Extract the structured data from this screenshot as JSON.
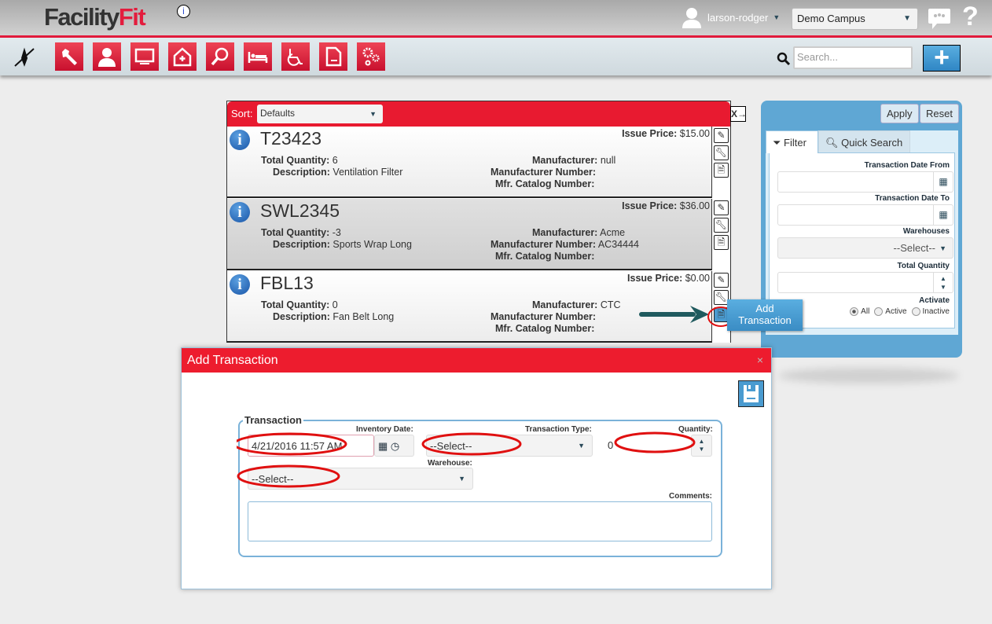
{
  "header": {
    "logo_a": "Facility",
    "logo_b": "Fit",
    "info": "i",
    "user": "larson-rodger",
    "campus": "Demo Campus"
  },
  "toolbar": {
    "nav_icons": [
      "wrench",
      "user",
      "monitor",
      "home-plus",
      "magnifier",
      "bed",
      "wheelchair",
      "document",
      "gears"
    ],
    "search_placeholder": "Search...",
    "add_label": "+"
  },
  "list": {
    "sort_label": "Sort:",
    "sort_value": "Defaults",
    "labels": {
      "issue_price": "Issue Price:",
      "total_quantity": "Total Quantity:",
      "description": "Description:",
      "manufacturer": "Manufacturer:",
      "manufacturer_number": "Manufacturer Number:",
      "catalog_number": "Mfr. Catalog Number:"
    },
    "items": [
      {
        "code": "T23423",
        "issue_price": "$15.00",
        "total_quantity": "6",
        "description": "Ventilation Filter",
        "manufacturer": "null",
        "manufacturer_number": "",
        "catalog_number": ""
      },
      {
        "code": "SWL2345",
        "issue_price": "$36.00",
        "total_quantity": "-3",
        "description": "Sports Wrap Long",
        "manufacturer": "Acme",
        "manufacturer_number": "AC34444",
        "catalog_number": ""
      },
      {
        "code": "FBL13",
        "issue_price": "$0.00",
        "total_quantity": "0",
        "description": "Fan Belt Long",
        "manufacturer": "CTC",
        "manufacturer_number": "",
        "catalog_number": ""
      }
    ]
  },
  "callout": {
    "line1": "Add",
    "line2": "Transaction"
  },
  "filter": {
    "apply": "Apply",
    "reset": "Reset",
    "tab_filter": "Filter",
    "tab_quick": "Quick Search",
    "date_from": "Transaction Date From",
    "date_to": "Transaction Date To",
    "warehouses": "Warehouses",
    "warehouses_value": "--Select--",
    "total_quantity": "Total Quantity",
    "activate": "Activate",
    "radios": [
      {
        "label": "All",
        "checked": true
      },
      {
        "label": "Active",
        "checked": false
      },
      {
        "label": "Inactive",
        "checked": false
      }
    ]
  },
  "modal": {
    "title": "Add Transaction",
    "close": "×",
    "legend": "Transaction",
    "inventory_date_label": "Inventory Date:",
    "inventory_date": "4/21/2016 11:57 AM",
    "type_label": "Transaction Type:",
    "type_value": "--Select--",
    "quantity_label": "Quantity:",
    "quantity": "0",
    "warehouse_label": "Warehouse:",
    "warehouse_value": "--Select--",
    "comments_label": "Comments:",
    "comments": ""
  },
  "colors": {
    "brand_red": "#e31c3d",
    "accent_blue": "#5fa7d4",
    "annotation_red": "#e01010",
    "arrow": "#1f5a5e"
  }
}
